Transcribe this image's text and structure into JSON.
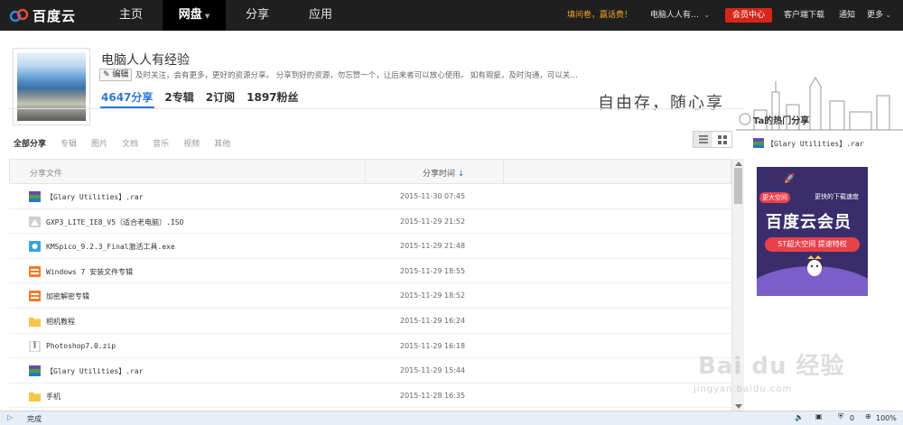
{
  "topbar": {
    "logo": "百度云",
    "nav": [
      "主页",
      "网盘",
      "分享",
      "应用"
    ],
    "promo": "填问卷，赢话费！",
    "user": "电脑人人有…",
    "vip": "会员中心",
    "download": "客户端下载",
    "notify": "通知",
    "more": "更多"
  },
  "profile": {
    "name": "电脑人人有经验",
    "edit": "编辑",
    "bio": "及时关注，会有更多，更好的资源分享。 分享到好的资源，勿忘赞一个，让后来者可以放心使用。 如有瑕疵，及时沟通，可以关…",
    "stats": [
      "4647分享",
      "2专辑",
      "2订阅",
      "1897粉丝"
    ],
    "slogan": "自由存，随心享"
  },
  "tabs": [
    "全部分享",
    "专辑",
    "图片",
    "文档",
    "音乐",
    "视频",
    "其他"
  ],
  "table": {
    "col_name": "分享文件",
    "col_time": "分享时间",
    "rows": [
      {
        "icon": "rar-icon",
        "name": "【Glary Utilities】.rar",
        "time": "2015-11-30 07:45"
      },
      {
        "icon": "iso-icon",
        "name": "GXP3_LITE_IE8_V5（适合老电脑）.ISO",
        "time": "2015-11-29 21:52"
      },
      {
        "icon": "exe-icon",
        "name": "KMSpico_9.2.3_Final激活工具.exe",
        "time": "2015-11-29 21:48"
      },
      {
        "icon": "album-icon",
        "name": "Windows 7 安装文件专辑",
        "time": "2015-11-29 18:55"
      },
      {
        "icon": "album-icon",
        "name": "加密解密专辑",
        "time": "2015-11-29 18:52"
      },
      {
        "icon": "folder-icon",
        "name": "相机教程",
        "time": "2015-11-29 16:24"
      },
      {
        "icon": "zip-icon",
        "name": "Photoshop7.0.zip",
        "time": "2015-11-29 16:18"
      },
      {
        "icon": "rar-icon",
        "name": "【Glary Utilities】.rar",
        "time": "2015-11-29 15:44"
      },
      {
        "icon": "folder-icon",
        "name": "手机",
        "time": "2015-11-28 16:35"
      }
    ]
  },
  "sidebar": {
    "title": "Ta的热门分享",
    "hot_file": "【Glary Utilities】.rar",
    "ad_tag1": "更大空间",
    "ad_tag2": "更快的下载速度",
    "ad_title": "百度云会员",
    "ad_sub": "5T超大空间  提速特权"
  },
  "statusbar": {
    "status": "完成",
    "count": "0",
    "zoom": "100%"
  },
  "watermark": {
    "main": "Bai du 经验",
    "sub": "jingyan.baidu.com"
  }
}
